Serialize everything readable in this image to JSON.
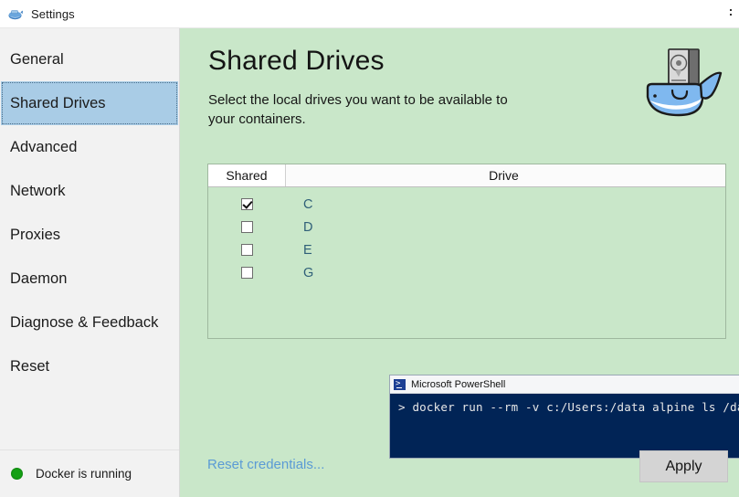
{
  "window": {
    "title": "Settings",
    "icon": "docker-whale-icon"
  },
  "sidebar": {
    "items": [
      {
        "label": "General",
        "selected": false
      },
      {
        "label": "Shared Drives",
        "selected": true
      },
      {
        "label": "Advanced",
        "selected": false
      },
      {
        "label": "Network",
        "selected": false
      },
      {
        "label": "Proxies",
        "selected": false
      },
      {
        "label": "Daemon",
        "selected": false
      },
      {
        "label": "Diagnose & Feedback",
        "selected": false
      },
      {
        "label": "Reset",
        "selected": false
      }
    ],
    "status": {
      "text": "Docker is running",
      "led_color": "#14a014"
    }
  },
  "main": {
    "title": "Shared Drives",
    "subtitle": "Select the local drives you want to be available to your containers.",
    "background_color": "#c9e7c9",
    "table": {
      "columns": [
        "Shared",
        "Drive"
      ],
      "rows": [
        {
          "shared": true,
          "drive": "C"
        },
        {
          "shared": false,
          "drive": "D"
        },
        {
          "shared": false,
          "drive": "E"
        },
        {
          "shared": false,
          "drive": "G"
        }
      ]
    },
    "terminal": {
      "title": "Microsoft PowerShell",
      "minimize_label": "—",
      "maximize_label": "☐",
      "close_label": "✕",
      "lines": [
        "> docker run --rm -v c:/Users:/data alpine ls /data"
      ],
      "background_color": "#012456"
    },
    "footer": {
      "reset_link": "Reset credentials...",
      "apply_label": "Apply",
      "link_color": "#5b9bd5"
    }
  }
}
